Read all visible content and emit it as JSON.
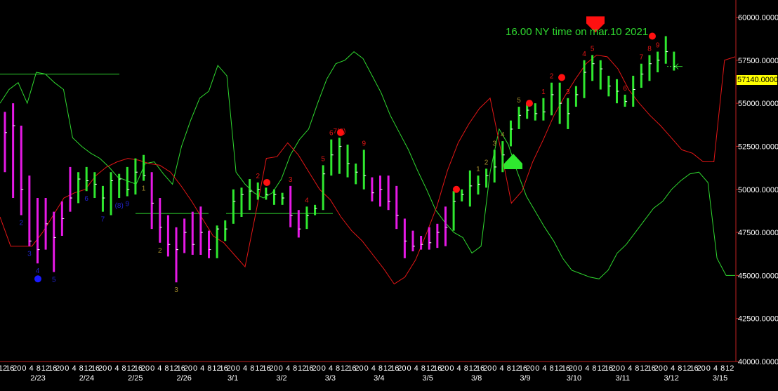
{
  "chart_data": {
    "type": "bar",
    "subtype": "ohlc-bars-with-indicator-bands",
    "annotation": "16.00 NY time on mar.10  2021",
    "last_price_label": "57140.0000",
    "ylim": [
      40000,
      61000
    ],
    "yticks": [
      {
        "value": 60000,
        "label": "60000.0000"
      },
      {
        "value": 57500,
        "label": "57500.0000"
      },
      {
        "value": 55000,
        "label": "55000.0000"
      },
      {
        "value": 52500,
        "label": "52500.0000"
      },
      {
        "value": 50000,
        "label": "50000.0000"
      },
      {
        "value": 47500,
        "label": "47500.0000"
      },
      {
        "value": 45000,
        "label": "45000.0000"
      },
      {
        "value": 42500,
        "label": "42500.0000"
      },
      {
        "value": 40000,
        "label": "40000.0000"
      }
    ],
    "x_hour_labels": [
      "12",
      "16",
      "20",
      "0",
      "4",
      "8",
      "12",
      "16",
      "20",
      "0",
      "4",
      "8",
      "12",
      "16",
      "20",
      "0",
      "4",
      "8",
      "12",
      "16",
      "20",
      "0",
      "4",
      "8",
      "12",
      "16",
      "20",
      "0",
      "4",
      "8",
      "12",
      "16",
      "20",
      "0",
      "4",
      "8",
      "12",
      "16",
      "20",
      "0",
      "4",
      "8",
      "12",
      "16",
      "20",
      "0",
      "4",
      "8",
      "12",
      "16",
      "20",
      "0",
      "4",
      "8",
      "12",
      "16",
      "20",
      "0",
      "4",
      "8",
      "12",
      "16",
      "20",
      "0",
      "4",
      "8",
      "12",
      "16",
      "20",
      "0",
      "4",
      "8",
      "12",
      "16",
      "20",
      "0",
      "4",
      "8",
      "12",
      "16",
      "20",
      "0",
      "4",
      "8",
      "12",
      "16",
      "20",
      "0",
      "4",
      "8",
      "12",
      "16",
      "20",
      "0",
      "4",
      "8",
      "12",
      "16",
      "20",
      "0",
      "4",
      "8",
      "12",
      "16",
      "20",
      "0",
      "4"
    ],
    "x_date_labels": [
      "2/23",
      "2/24",
      "2/25",
      "2/26",
      "3/1",
      "3/2",
      "3/3",
      "3/4",
      "3/5",
      "3/8",
      "3/9",
      "3/10",
      "3/11",
      "3/12",
      "3/15"
    ],
    "bars": [
      {
        "c": "m",
        "h": 54500,
        "l": 51000,
        "cl": 53300
      },
      {
        "c": "m",
        "h": 55000,
        "l": 49500,
        "cl": 53700
      },
      {
        "c": "m",
        "h": 53700,
        "l": 48500,
        "cl": 50000
      },
      {
        "c": "m",
        "h": 50800,
        "l": 46700,
        "cl": 47000
      },
      {
        "c": "m",
        "h": 49500,
        "l": 45700,
        "cl": 46500
      },
      {
        "c": "m",
        "h": 49500,
        "l": 46500,
        "cl": 48000
      },
      {
        "c": "m",
        "h": 48700,
        "l": 45200,
        "cl": 47200
      },
      {
        "c": "m",
        "h": 49300,
        "l": 47300,
        "cl": 48300
      },
      {
        "c": "m",
        "h": 51300,
        "l": 48700,
        "cl": 49500
      },
      {
        "c": "g",
        "h": 51000,
        "l": 49200,
        "cl": 50600
      },
      {
        "c": "g",
        "h": 51300,
        "l": 49900,
        "cl": 50500
      },
      {
        "c": "g",
        "h": 51000,
        "l": 49500,
        "cl": 50300
      },
      {
        "c": "g",
        "h": 50200,
        "l": 48700,
        "cl": 49500
      },
      {
        "c": "g",
        "h": 51000,
        "l": 48500,
        "cl": 50500
      },
      {
        "c": "g",
        "h": 50900,
        "l": 49500,
        "cl": 50600
      },
      {
        "c": "g",
        "h": 51300,
        "l": 49600,
        "cl": 50000
      },
      {
        "c": "g",
        "h": 51800,
        "l": 49700,
        "cl": 51000
      },
      {
        "c": "g",
        "h": 52000,
        "l": 50500,
        "cl": 50800
      },
      {
        "c": "m",
        "h": 51000,
        "l": 47700,
        "cl": 49200
      },
      {
        "c": "m",
        "h": 49500,
        "l": 46900,
        "cl": 47800
      },
      {
        "c": "m",
        "h": 48500,
        "l": 46100,
        "cl": 46800
      },
      {
        "c": "m",
        "h": 47800,
        "l": 44600,
        "cl": 46500
      },
      {
        "c": "m",
        "h": 48300,
        "l": 46300,
        "cl": 47500
      },
      {
        "c": "m",
        "h": 48700,
        "l": 46200,
        "cl": 46800
      },
      {
        "c": "m",
        "h": 49000,
        "l": 46200,
        "cl": 47500
      },
      {
        "c": "m",
        "h": 47600,
        "l": 46000,
        "cl": 46500
      },
      {
        "c": "g",
        "h": 47900,
        "l": 46000,
        "cl": 47700
      },
      {
        "c": "g",
        "h": 48200,
        "l": 47000,
        "cl": 47700
      },
      {
        "c": "g",
        "h": 50000,
        "l": 48000,
        "cl": 49300
      },
      {
        "c": "g",
        "h": 50100,
        "l": 48400,
        "cl": 49700
      },
      {
        "c": "g",
        "h": 50600,
        "l": 48800,
        "cl": 49900
      },
      {
        "c": "g",
        "h": 50400,
        "l": 49400,
        "cl": 50000
      },
      {
        "c": "g",
        "h": 50100,
        "l": 49400,
        "cl": 49700
      },
      {
        "c": "g",
        "h": 50000,
        "l": 49100,
        "cl": 49700
      },
      {
        "c": "g",
        "h": 49800,
        "l": 49100,
        "cl": 49500
      },
      {
        "c": "m",
        "h": 50200,
        "l": 47800,
        "cl": 48500
      },
      {
        "c": "m",
        "h": 48800,
        "l": 47200,
        "cl": 47700
      },
      {
        "c": "g",
        "h": 49000,
        "l": 47700,
        "cl": 48500
      },
      {
        "c": "g",
        "h": 49100,
        "l": 48500,
        "cl": 48900
      },
      {
        "c": "g",
        "h": 51400,
        "l": 48800,
        "cl": 50900
      },
      {
        "c": "g",
        "h": 52900,
        "l": 50800,
        "cl": 52000
      },
      {
        "c": "g",
        "h": 53000,
        "l": 50900,
        "cl": 52500
      },
      {
        "c": "g",
        "h": 52600,
        "l": 50700,
        "cl": 51500
      },
      {
        "c": "g",
        "h": 51500,
        "l": 50300,
        "cl": 51000
      },
      {
        "c": "g",
        "h": 52300,
        "l": 50000,
        "cl": 50800
      },
      {
        "c": "m",
        "h": 50700,
        "l": 49300,
        "cl": 49800
      },
      {
        "c": "m",
        "h": 50800,
        "l": 49000,
        "cl": 50000
      },
      {
        "c": "m",
        "h": 50800,
        "l": 48800,
        "cl": 49300
      },
      {
        "c": "m",
        "h": 50200,
        "l": 47700,
        "cl": 48500
      },
      {
        "c": "m",
        "h": 48300,
        "l": 46000,
        "cl": 47000
      },
      {
        "c": "m",
        "h": 47600,
        "l": 46400,
        "cl": 46700
      },
      {
        "c": "m",
        "h": 47300,
        "l": 46500,
        "cl": 46800
      },
      {
        "c": "m",
        "h": 47800,
        "l": 46500,
        "cl": 46900
      },
      {
        "c": "m",
        "h": 48000,
        "l": 46600,
        "cl": 47500
      },
      {
        "c": "m",
        "h": 49000,
        "l": 46700,
        "cl": 47800
      },
      {
        "c": "g",
        "h": 49900,
        "l": 47600,
        "cl": 49300
      },
      {
        "c": "g",
        "h": 50000,
        "l": 49300,
        "cl": 49700
      },
      {
        "c": "g",
        "h": 51100,
        "l": 49000,
        "cl": 50200
      },
      {
        "c": "g",
        "h": 50800,
        "l": 49700,
        "cl": 50300
      },
      {
        "c": "g",
        "h": 51200,
        "l": 50100,
        "cl": 50800
      },
      {
        "c": "g",
        "h": 52300,
        "l": 50400,
        "cl": 51300
      },
      {
        "c": "g",
        "h": 52800,
        "l": 51000,
        "cl": 52000
      },
      {
        "c": "g",
        "h": 54000,
        "l": 52500,
        "cl": 53500
      },
      {
        "c": "g",
        "h": 54800,
        "l": 53500,
        "cl": 54300
      },
      {
        "c": "g",
        "h": 55000,
        "l": 54100,
        "cl": 54600
      },
      {
        "c": "g",
        "h": 55000,
        "l": 54000,
        "cl": 54400
      },
      {
        "c": "g",
        "h": 55300,
        "l": 54000,
        "cl": 54500
      },
      {
        "c": "g",
        "h": 56200,
        "l": 54300,
        "cl": 55500
      },
      {
        "c": "g",
        "h": 56200,
        "l": 53800,
        "cl": 55000
      },
      {
        "c": "g",
        "h": 55300,
        "l": 53500,
        "cl": 54400
      },
      {
        "c": "g",
        "h": 56000,
        "l": 54800,
        "cl": 55500
      },
      {
        "c": "g",
        "h": 57500,
        "l": 55300,
        "cl": 56800
      },
      {
        "c": "g",
        "h": 57800,
        "l": 56300,
        "cl": 57300
      },
      {
        "c": "g",
        "h": 57500,
        "l": 55800,
        "cl": 57000
      },
      {
        "c": "g",
        "h": 56600,
        "l": 55400,
        "cl": 56000
      },
      {
        "c": "g",
        "h": 56400,
        "l": 55000,
        "cl": 55700
      },
      {
        "c": "g",
        "h": 55500,
        "l": 54800,
        "cl": 55100
      },
      {
        "c": "g",
        "h": 56600,
        "l": 54800,
        "cl": 55800
      },
      {
        "c": "g",
        "h": 57300,
        "l": 55900,
        "cl": 56700
      },
      {
        "c": "g",
        "h": 57800,
        "l": 56300,
        "cl": 57300
      },
      {
        "c": "g",
        "h": 58000,
        "l": 56800,
        "cl": 57500
      },
      {
        "c": "g",
        "h": 58900,
        "l": 57300,
        "cl": 58000
      },
      {
        "c": "g",
        "h": 58000,
        "l": 56900,
        "cl": 57140
      }
    ],
    "series": [
      {
        "name": "",
        "color": "#2fd82f",
        "y": [
          55000,
          55800,
          56200,
          55000,
          56800,
          56700,
          56200,
          55800,
          53000,
          52500,
          52100,
          51800,
          51300,
          50700,
          50500,
          50300,
          51500,
          51600,
          50900,
          50300,
          52500,
          54000,
          55300,
          55700,
          57200,
          56600,
          51000,
          50300,
          49800,
          49500,
          49800,
          50600,
          52000,
          52900,
          53500,
          55000,
          56400,
          57300,
          57500,
          58000,
          57600,
          56600,
          55600,
          54300,
          53300,
          52300,
          51100,
          50000,
          48800,
          48100,
          47500,
          47200,
          46300,
          46700,
          51000,
          53500,
          52600,
          51000,
          49600,
          48700,
          47800,
          47000,
          46000,
          45300,
          45100,
          44900,
          44800,
          45300,
          46300,
          46800,
          47500,
          48200,
          48900,
          49300,
          50000,
          50500,
          50900,
          51000,
          50400,
          46000,
          45000,
          45000
        ],
        "xs": [
          0,
          10,
          14,
          31,
          37,
          53,
          64,
          90,
          110,
          124,
          146,
          162,
          175,
          192,
          206,
          218,
          233,
          245,
          262,
          281,
          300,
          311,
          322,
          334,
          342,
          351,
          372,
          395,
          420,
          450,
          474,
          490,
          504,
          512,
          530,
          551,
          565,
          575,
          589,
          607,
          625,
          640,
          660,
          671,
          681,
          700,
          713,
          727,
          741,
          762,
          783,
          801,
          817,
          835,
          852,
          880,
          906,
          927,
          960,
          990,
          1020,
          1018,
          1043,
          1030,
          1047,
          0,
          0,
          0,
          0,
          0,
          0,
          0,
          0,
          0,
          0,
          0,
          0,
          0,
          0,
          0,
          0,
          0
        ]
      },
      {
        "name": "",
        "color": "#e21616",
        "y": [
          48400,
          46700,
          46700,
          46700,
          47500,
          48500,
          49500,
          49800,
          50000,
          50800,
          51300,
          51600,
          51800,
          51700,
          51500,
          51400,
          51000,
          50200,
          49300,
          48300,
          47300,
          46900,
          46200,
          45500,
          48600,
          51800,
          51900,
          52700,
          52000,
          51000,
          50000,
          49400,
          48400,
          47600,
          47000,
          46200,
          45400,
          44500,
          44900,
          45900,
          47400,
          49000,
          51100,
          52700,
          53800,
          54700,
          55300,
          52300,
          49200,
          49900,
          51600,
          52900,
          54300,
          55400,
          56400,
          57300,
          57800,
          57700,
          57000,
          55800,
          55000,
          54300,
          53700,
          53000,
          52300,
          52100,
          51600,
          51600,
          57500,
          57700
        ]
      }
    ],
    "markers": [
      {
        "type": "counter",
        "text": "2",
        "color": "#2222cc",
        "bar": 2,
        "pos": "below"
      },
      {
        "type": "counter",
        "text": "3",
        "color": "#2222cc",
        "bar": 3,
        "pos": "below"
      },
      {
        "type": "counter",
        "text": "4",
        "color": "#2222cc",
        "bar": 4,
        "pos": "below"
      },
      {
        "type": "counter",
        "text": "5",
        "color": "#2222cc",
        "bar": 6,
        "pos": "below"
      },
      {
        "type": "counter",
        "text": "6",
        "color": "#2222cc",
        "bar": 10,
        "pos": "below"
      },
      {
        "type": "counter",
        "text": "7",
        "color": "#2222cc",
        "bar": 12,
        "pos": "below"
      },
      {
        "type": "counter",
        "text": "(8)",
        "color": "#2222cc",
        "bar": 14,
        "pos": "below"
      },
      {
        "type": "counter",
        "text": "9",
        "color": "#2222cc",
        "bar": 15,
        "pos": "below"
      },
      {
        "type": "counter",
        "text": "1",
        "color": "#a08a2a",
        "bar": 17,
        "pos": "below"
      },
      {
        "type": "counter",
        "text": "2",
        "color": "#a08a2a",
        "bar": 19,
        "pos": "below"
      },
      {
        "type": "counter",
        "text": "3",
        "color": "#a08a2a",
        "bar": 21,
        "pos": "below"
      },
      {
        "type": "counter",
        "text": "2",
        "color": "#e21616",
        "bar": 31,
        "pos": "above"
      },
      {
        "type": "counter",
        "text": "3",
        "color": "#e21616",
        "bar": 35,
        "pos": "above"
      },
      {
        "type": "counter",
        "text": "4",
        "color": "#e21616",
        "bar": 37,
        "pos": "above"
      },
      {
        "type": "counter",
        "text": "5",
        "color": "#e21616",
        "bar": 39,
        "pos": "above"
      },
      {
        "type": "counter",
        "text": "6",
        "color": "#e21616",
        "bar": 40,
        "pos": "above"
      },
      {
        "type": "counter",
        "text": "7(8)",
        "color": "#e21616",
        "bar": 41,
        "pos": "above"
      },
      {
        "type": "counter",
        "text": "9",
        "color": "#e21616",
        "bar": 44,
        "pos": "above"
      },
      {
        "type": "counter",
        "text": "1",
        "color": "#a08a2a",
        "bar": 58,
        "pos": "above"
      },
      {
        "type": "counter",
        "text": "2",
        "color": "#a08a2a",
        "bar": 59,
        "pos": "above"
      },
      {
        "type": "counter",
        "text": "3",
        "color": "#a08a2a",
        "bar": 60,
        "pos": "above"
      },
      {
        "type": "counter",
        "text": "4",
        "color": "#a08a2a",
        "bar": 61,
        "pos": "above"
      },
      {
        "type": "counter",
        "text": "5",
        "color": "#a08a2a",
        "bar": 63,
        "pos": "above"
      },
      {
        "type": "counter",
        "text": "1",
        "color": "#e21616",
        "bar": 66,
        "pos": "above"
      },
      {
        "type": "counter",
        "text": "2",
        "color": "#e21616",
        "bar": 67,
        "pos": "above"
      },
      {
        "type": "counter",
        "text": "3",
        "color": "#e21616",
        "bar": 69,
        "pos": "above"
      },
      {
        "type": "counter",
        "text": "4",
        "color": "#e21616",
        "bar": 71,
        "pos": "above"
      },
      {
        "type": "counter",
        "text": "5",
        "color": "#e21616",
        "bar": 72,
        "pos": "above"
      },
      {
        "type": "counter",
        "text": "6",
        "color": "#e21616",
        "bar": 76,
        "pos": "above"
      },
      {
        "type": "counter",
        "text": "7",
        "color": "#e21616",
        "bar": 78,
        "pos": "above"
      },
      {
        "type": "counter",
        "text": "8",
        "color": "#e21616",
        "bar": 79,
        "pos": "above"
      },
      {
        "type": "counter",
        "text": "9",
        "color": "#e21616",
        "bar": 80,
        "pos": "above"
      }
    ]
  }
}
